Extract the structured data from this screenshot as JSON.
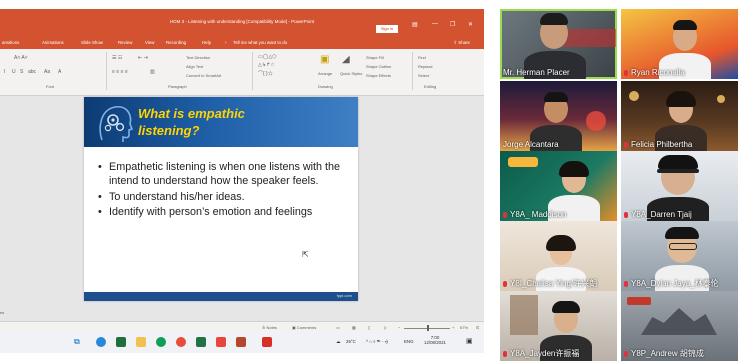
{
  "powerpoint": {
    "title": "HOM 3 - Listening with understanding [Compatibility Mode] - PowerPoint",
    "sign_in": "Sign in",
    "tabs": [
      "ansitions",
      "Animations",
      "Slide Show",
      "Review",
      "View",
      "Recording",
      "Help"
    ],
    "tell_me": "Tell me what you want to do",
    "share": "Share",
    "ribbon_groups": {
      "font": "Font",
      "paragraph": "Paragraph",
      "drawing": "Drawing",
      "editing": "Editing"
    },
    "ribbon_items": {
      "text_direction": "Text Direction",
      "align_text": "Align Text",
      "convert_smartart": "Convert to SmartArt",
      "arrange": "Arrange",
      "quick_styles": "Quick Styles",
      "shape_fill": "Shape Fill",
      "shape_outline": "Shape Outline",
      "shape_effects": "Shape Effects",
      "find": "Find",
      "replace": "Replace",
      "select": "Select"
    },
    "slide": {
      "title_line1": "What is empathic",
      "title_line2": "listening?",
      "bullets": [
        "Empathetic listening is when one listens with the  intend to understand how the speaker feels.",
        "To understand his/her ideas.",
        "Identify with person’s emotion and feelings"
      ],
      "footer_url": "fppt.com"
    },
    "file_edge": "es",
    "status": {
      "notes": "Notes",
      "comments": "Comments",
      "zoom": "67%"
    },
    "tray": {
      "temperature": "26°C",
      "lang": "ENG",
      "time": "7:00",
      "date": "12/08/2021"
    }
  },
  "participants": [
    {
      "name": "Mr. Herman Placer",
      "muted": false,
      "active": true
    },
    {
      "name": "Ryan Riconalla",
      "muted": true,
      "active": false
    },
    {
      "name": "Jorge Alcantara",
      "muted": false,
      "active": false
    },
    {
      "name": "Felicia Philbertha",
      "muted": true,
      "active": false
    },
    {
      "name": "Y8A_ Maddison",
      "muted": true,
      "active": false
    },
    {
      "name": "Y8A_Darren Tjaij",
      "muted": true,
      "active": false
    },
    {
      "name": "Y8I_Chalisa Ying/许兴朗",
      "muted": true,
      "active": false
    },
    {
      "name": "Y8A_Dylan Jaya_林泰伦",
      "muted": true,
      "active": false
    },
    {
      "name": "Y8A_Jayden许振福",
      "muted": true,
      "active": false
    },
    {
      "name": "Y8P_Andrew 胡锦成",
      "muted": true,
      "active": false
    }
  ],
  "colors": {
    "ppt_accent": "#d35230",
    "slide_title": "#ffd400",
    "active_speaker": "#9bdc4a",
    "muted_icon": "#e0323c"
  }
}
